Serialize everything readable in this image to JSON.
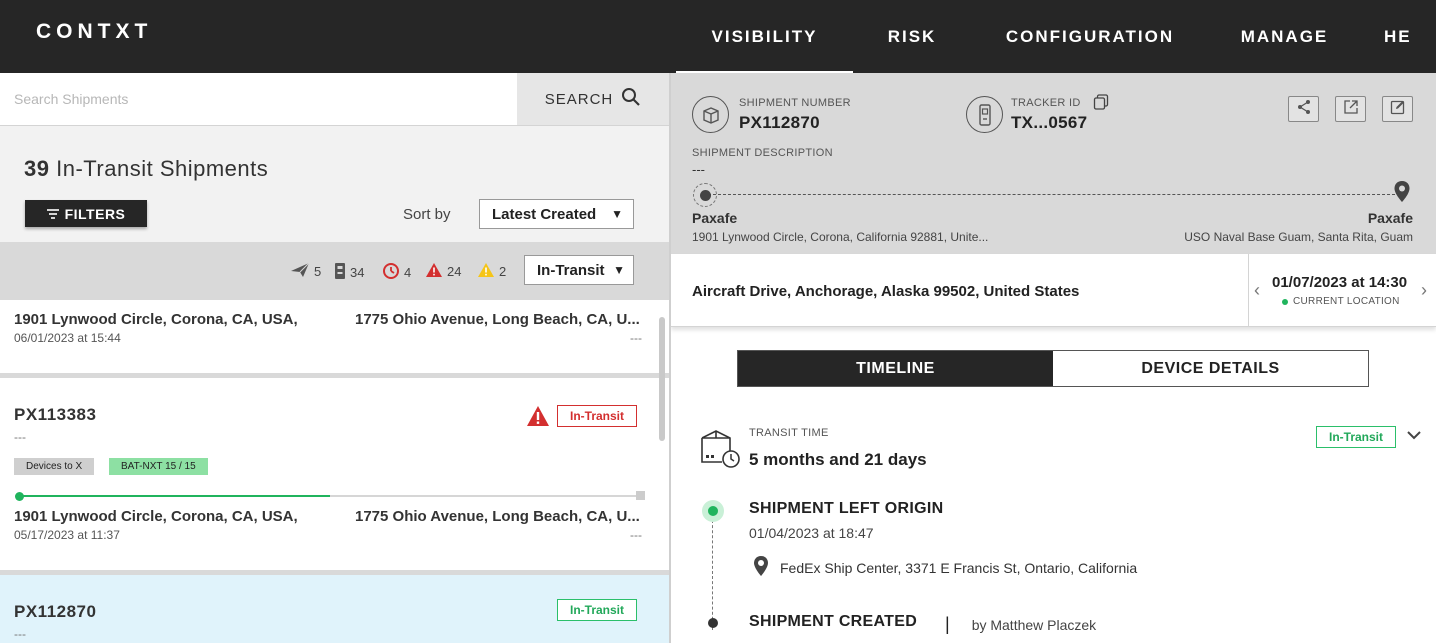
{
  "app": {
    "logo": "CONTXT"
  },
  "nav": {
    "items": [
      "VISIBILITY",
      "RISK",
      "CONFIGURATION",
      "MANAGE",
      "HE"
    ]
  },
  "search": {
    "placeholder": "Search Shipments",
    "button_label": "SEARCH"
  },
  "list_header": {
    "count": "39",
    "title": "In-Transit Shipments",
    "filters_label": "FILTERS",
    "sort_label": "Sort by",
    "sort_value": "Latest Created",
    "stats": {
      "sent": "5",
      "devices": "34",
      "delayed": "4",
      "alerts_red": "24",
      "alerts_yellow": "2"
    },
    "status_filter": "In-Transit"
  },
  "shipments": [
    {
      "origin": "1901 Lynwood Circle, Corona, CA, USA,",
      "destination": "1775 Ohio Avenue, Long Beach, CA, U...",
      "date": "06/01/2023 at 15:44",
      "eta": "---"
    },
    {
      "id": "PX113383",
      "desc": "---",
      "status": "In-Transit",
      "tags": [
        "Devices to X",
        "BAT-NXT 15 / 15"
      ],
      "progress": 0.5,
      "origin": "1901 Lynwood Circle, Corona, CA, USA,",
      "destination": "1775 Ohio Avenue, Long Beach, CA, U...",
      "date": "05/17/2023 at 11:37",
      "eta": "---"
    },
    {
      "id": "PX112870",
      "desc": "---",
      "status": "In-Transit"
    }
  ],
  "detail": {
    "shipment_number_label": "SHIPMENT NUMBER",
    "shipment_number": "PX112870",
    "tracker_id_label": "TRACKER ID",
    "tracker_id": "TX...0567",
    "description_label": "SHIPMENT DESCRIPTION",
    "description": "---",
    "origin_name": "Paxafe",
    "origin_address": "1901 Lynwood Circle, Corona, California 92881, Unite...",
    "destination_name": "Paxafe",
    "destination_address": "USO Naval Base Guam, Santa Rita, Guam",
    "current_address": "Aircraft Drive, Anchorage, Alaska 99502, United States",
    "current_time": "01/07/2023 at 14:30",
    "current_label": "CURRENT LOCATION",
    "tabs": [
      "TIMELINE",
      "DEVICE DETAILS"
    ],
    "transit_time_label": "TRANSIT TIME",
    "transit_time": "5 months and 21 days",
    "transit_status": "In-Transit",
    "timeline": [
      {
        "title": "SHIPMENT LEFT ORIGIN",
        "time": "01/04/2023 at 18:47",
        "location": "FedEx Ship Center, 3371 E Francis St, Ontario, California"
      },
      {
        "title": "SHIPMENT CREATED",
        "separator": "|",
        "by": "by Matthew Placzek"
      }
    ]
  },
  "colors": {
    "nav_bg": "#262626",
    "accent_green": "#20b45d",
    "alert_red": "#d32f2f",
    "panel_grey": "#d9d9d9"
  }
}
